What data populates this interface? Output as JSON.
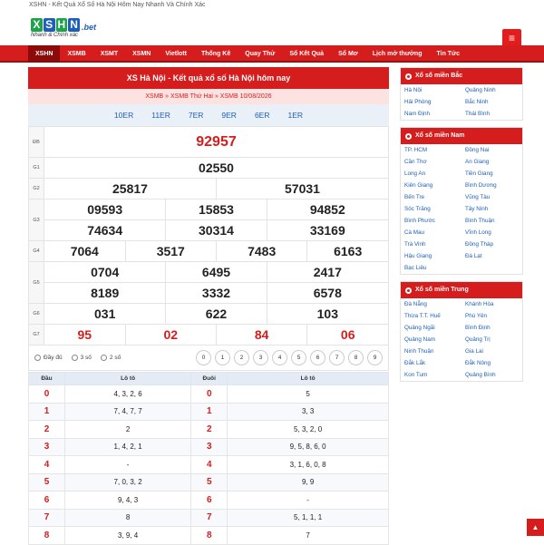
{
  "topbar": {
    "text": "XSHN - Kết Quả Xổ Số Hà Nội Hôm Nay Nhanh Và Chính Xác"
  },
  "logo": {
    "letters": [
      "X",
      "S",
      "H",
      "N"
    ],
    "suffix": ".bet",
    "slogan": "Nhanh & Chính xác"
  },
  "menu": {
    "icon": "hamburger-icon",
    "glyph": "≡"
  },
  "nav": [
    "XSHN",
    "XSMB",
    "XSMT",
    "XSMN",
    "Vietlott",
    "Thống Kê",
    "Quay Thử",
    "Sổ Kết Quả",
    "Sổ Mơ",
    "Lịch mở thưởng",
    "Tin Tức"
  ],
  "main": {
    "title": "XS Hà Nội - Kết quả xổ số Hà Nội hôm nay",
    "crumb": [
      "XSMB",
      "»",
      "XSMB Thứ Hai",
      "»",
      "XSMB 10/08/2026"
    ],
    "codes": [
      "10ER",
      "11ER",
      "7ER",
      "9ER",
      "6ER",
      "1ER"
    ],
    "prizes": {
      "db_label": "ĐB",
      "db": "92957",
      "g1_label": "G1",
      "g1": "02550",
      "g2_label": "G2",
      "g2": [
        "25817",
        "57031"
      ],
      "g3_label": "G3",
      "g3": [
        "09593",
        "15853",
        "94852",
        "74634",
        "30314",
        "33169"
      ],
      "g4_label": "G4",
      "g4": [
        "7064",
        "3517",
        "7483",
        "6163"
      ],
      "g5_label": "G5",
      "g5": [
        "0704",
        "6495",
        "2417",
        "8189",
        "3332",
        "6578"
      ],
      "g6_label": "G6",
      "g6": [
        "031",
        "622",
        "103"
      ],
      "g7_label": "G7",
      "g7": [
        "95",
        "02",
        "84",
        "06"
      ]
    },
    "filter": {
      "options": [
        "Đầy đủ",
        "3 số",
        "2 số"
      ],
      "digits": [
        "0",
        "1",
        "2",
        "3",
        "4",
        "5",
        "6",
        "7",
        "8",
        "9"
      ]
    }
  },
  "loto": {
    "headers": [
      "Đầu",
      "Lô tô",
      "Đuôi",
      "Lô tô"
    ],
    "rows": [
      [
        "0",
        "4, 3, 2, 6",
        "0",
        "5"
      ],
      [
        "1",
        "7, 4, 7, 7",
        "1",
        "3, 3"
      ],
      [
        "2",
        "2",
        "2",
        "5, 3, 2, 0"
      ],
      [
        "3",
        "1, 4, 2, 1",
        "3",
        "9, 5, 8, 6, 0"
      ],
      [
        "4",
        "-",
        "4",
        "3, 1, 6, 0, 8"
      ],
      [
        "5",
        "7, 0, 3, 2",
        "5",
        "9, 9"
      ],
      [
        "6",
        "9, 4, 3",
        "6",
        "-"
      ],
      [
        "7",
        "8",
        "7",
        "5, 1, 1, 1"
      ],
      [
        "8",
        "3, 9, 4",
        "8",
        "7"
      ]
    ]
  },
  "sidebar": {
    "bac": {
      "title": "Xổ số miền Bắc",
      "items": [
        "Hà Nội",
        "Quảng Ninh",
        "Hải Phòng",
        "Bắc Ninh",
        "Nam Định",
        "Thái Bình"
      ]
    },
    "nam": {
      "title": "Xổ số miền Nam",
      "items": [
        "TP. HCM",
        "Đồng Nai",
        "Cần Thơ",
        "An Giang",
        "Long An",
        "Tiền Giang",
        "Kiên Giang",
        "Bình Dương",
        "Bến Tre",
        "Vũng Tàu",
        "Sóc Trăng",
        "Tây Ninh",
        "Bình Phước",
        "Bình Thuận",
        "Cà Mau",
        "Vĩnh Long",
        "Trà Vinh",
        "Đồng Tháp",
        "Hậu Giang",
        "Đà Lạt",
        "Bạc Liêu"
      ]
    },
    "trung": {
      "title": "Xổ số miền Trung",
      "items": [
        "Đà Nẵng",
        "Khánh Hòa",
        "Thừa T.T. Huế",
        "Phú Yên",
        "Quảng Ngãi",
        "Bình Định",
        "Quảng Nam",
        "Quảng Trị",
        "Ninh Thuận",
        "Gia Lai",
        "Đắk Lắk",
        "Đắk Nông",
        "Kon Tum",
        "Quảng Bình"
      ]
    }
  },
  "totop": {
    "icon": "arrow-up-icon",
    "glyph": "▲"
  },
  "colors": {
    "brand_red": "#d51d1d",
    "link_blue": "#1d5fb8",
    "logo_green": "#1fa34a"
  }
}
